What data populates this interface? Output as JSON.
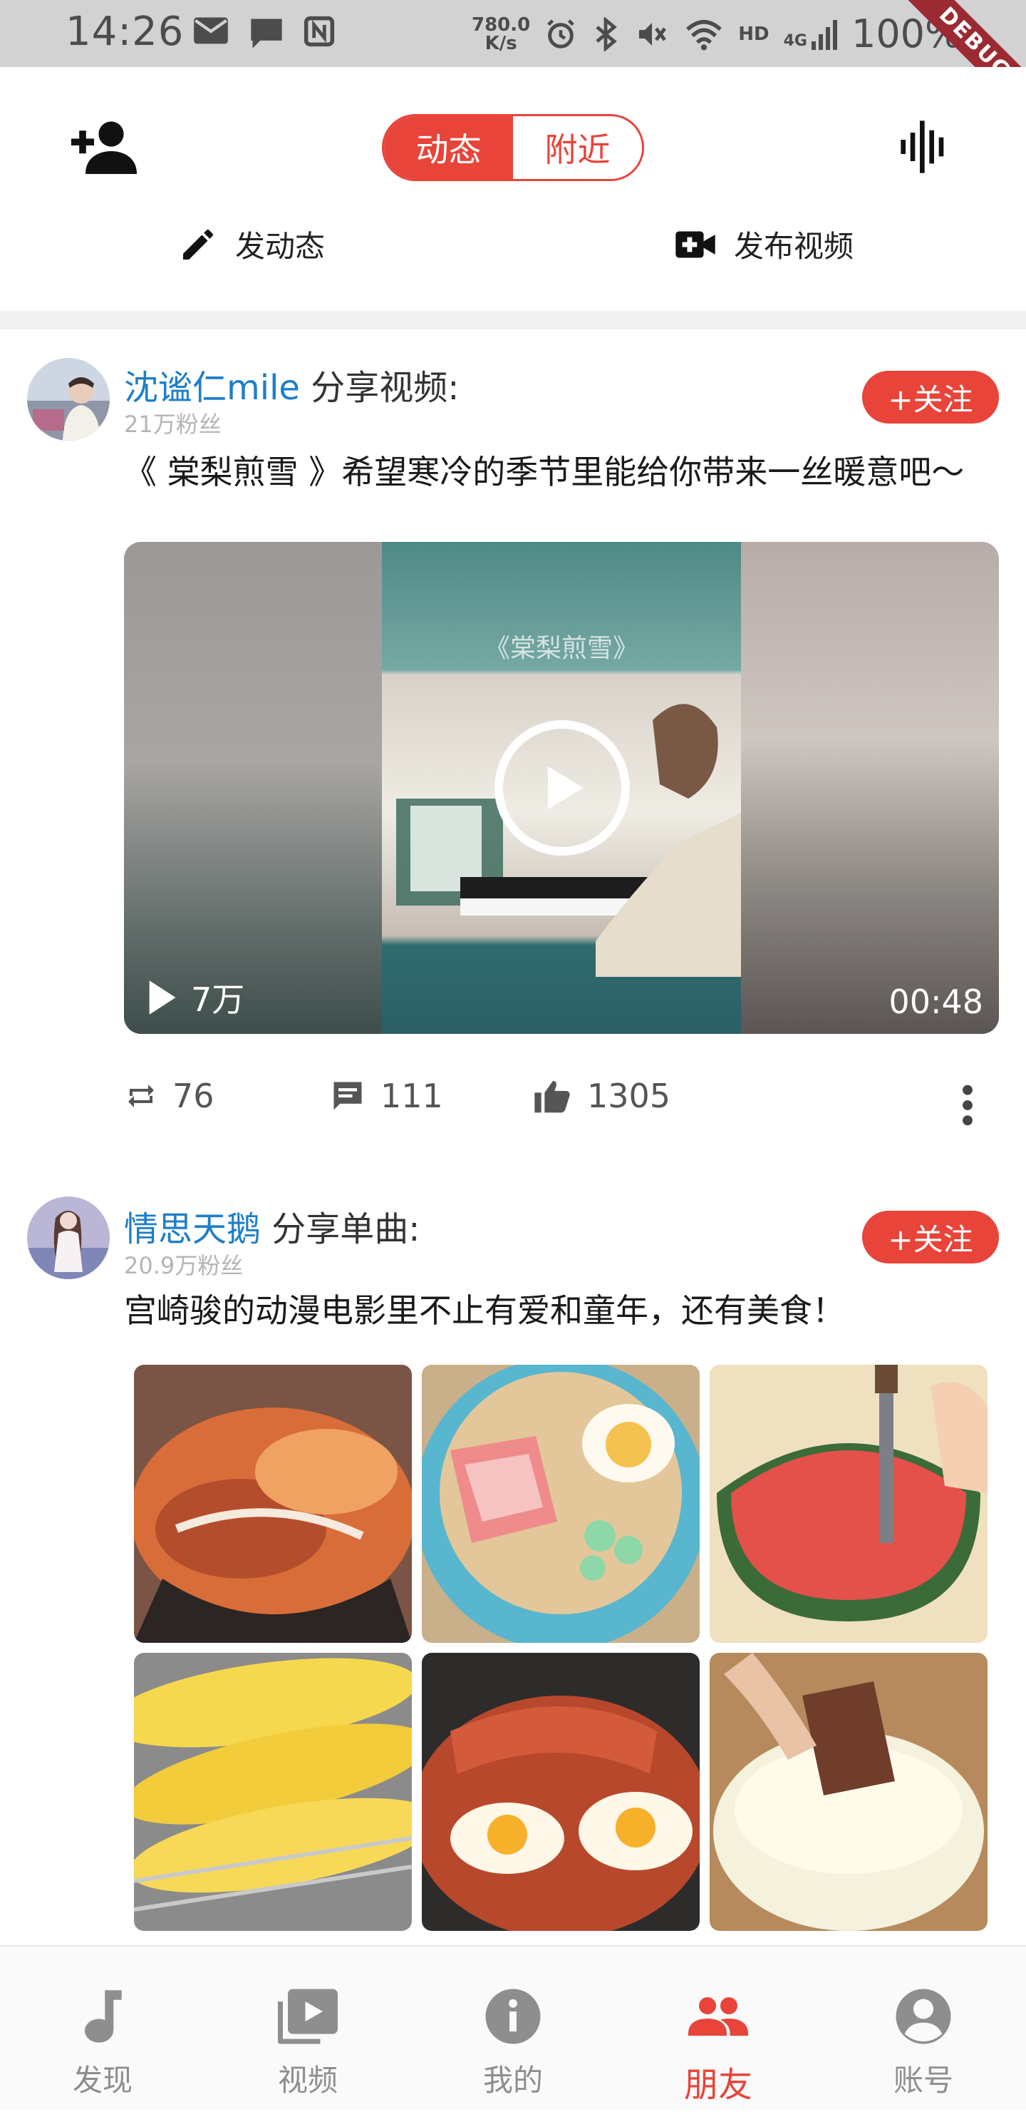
{
  "status_bar": {
    "time": "14:26",
    "net_speed_value": "780.0",
    "net_speed_unit": "K/s",
    "hd_label": "HD",
    "signal_label": "4G",
    "battery": "100%",
    "debug_label": "DEBUG"
  },
  "top_nav": {
    "tabs": [
      {
        "label": "动态",
        "active": true
      },
      {
        "label": "附近",
        "active": false
      }
    ],
    "accent_color": "#e8443a"
  },
  "post_actions": {
    "post_moment": "发动态",
    "post_video": "发布视频"
  },
  "feed": [
    {
      "author": "沈谧仁mile",
      "action": "分享视频:",
      "fans": "21万粉丝",
      "follow_label": "+关注",
      "text": "《 棠梨煎雪 》希望寒冷的季节里能给你带来一丝暖意吧～",
      "video": {
        "overlay_title": "《棠梨煎雪》",
        "plays": "7万",
        "duration": "00:48"
      },
      "stats": {
        "reposts": "76",
        "comments": "111",
        "likes": "1305"
      }
    },
    {
      "author": "情思天鹅",
      "action": "分享单曲:",
      "fans": "20.9万粉丝",
      "follow_label": "+关注",
      "text": "宫崎骏的动漫电影里不止有爱和童年，还有美食！",
      "image_count_visible": 6
    }
  ],
  "bottom_nav": {
    "items": [
      {
        "label": "发现",
        "icon": "music-note-icon",
        "active": false
      },
      {
        "label": "视频",
        "icon": "video-library-icon",
        "active": false
      },
      {
        "label": "我的",
        "icon": "info-icon",
        "active": false
      },
      {
        "label": "朋友",
        "icon": "people-icon",
        "active": true
      },
      {
        "label": "账号",
        "icon": "account-icon",
        "active": false
      }
    ]
  }
}
